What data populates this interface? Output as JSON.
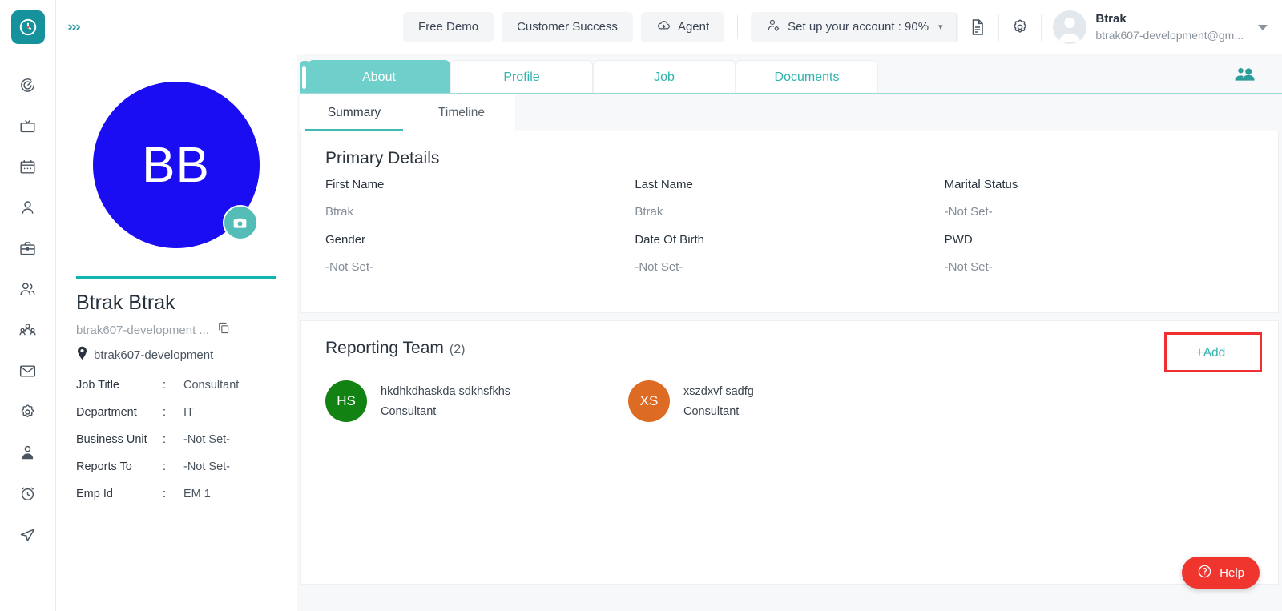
{
  "topbar": {
    "logo_icon": "clock-logo-icon",
    "expand_icon": "chevron-double-right-icon",
    "nav_items": [
      {
        "label": "Free Demo",
        "icon": null
      },
      {
        "label": "Customer Success",
        "icon": null
      },
      {
        "label": "Agent",
        "icon": "cloud-download-icon"
      }
    ],
    "setup": {
      "label": "Set up your account : 90%",
      "icon": "person-gear-icon",
      "caret": "caret-down-icon"
    },
    "doc_icon": "document-icon",
    "settings_icon": "gear-icon",
    "user": {
      "name": "Btrak",
      "email": "btrak607-development@gm...",
      "avatar_icon": "user-avatar-icon",
      "caret": "caret-down-icon"
    }
  },
  "sidebar": {
    "items": [
      {
        "name": "dashboard",
        "icon": "target-spiral-icon"
      },
      {
        "name": "media",
        "icon": "tv-icon"
      },
      {
        "name": "calendar",
        "icon": "calendar-icon"
      },
      {
        "name": "profile",
        "icon": "person-icon"
      },
      {
        "name": "jobs",
        "icon": "briefcase-icon"
      },
      {
        "name": "employees",
        "icon": "people-icon"
      },
      {
        "name": "org-chart",
        "icon": "org-group-icon"
      },
      {
        "name": "mail",
        "icon": "envelope-icon"
      },
      {
        "name": "settings",
        "icon": "gear-icon"
      },
      {
        "name": "account",
        "icon": "user-badge-icon"
      },
      {
        "name": "time-tracking",
        "icon": "alarm-clock-icon"
      },
      {
        "name": "send",
        "icon": "paper-plane-icon"
      }
    ]
  },
  "profile": {
    "initials": "BB",
    "avatar_color": "#1A0DF2",
    "camera_icon": "camera-icon",
    "full_name": "Btrak Btrak",
    "email": "btrak607-development ...",
    "copy_icon": "copy-icon",
    "location_icon": "location-pin-icon",
    "location": "btrak607-development",
    "fields": [
      {
        "key": "Job Title",
        "sep": ":",
        "value": "Consultant"
      },
      {
        "key": "Department",
        "sep": ":",
        "value": "IT"
      },
      {
        "key": "Business Unit",
        "sep": ":",
        "value": "-Not Set-"
      },
      {
        "key": "Reports To",
        "sep": ":",
        "value": "-Not Set-"
      },
      {
        "key": "Emp Id",
        "sep": ":",
        "value": "EM 1"
      }
    ]
  },
  "main": {
    "tabs": [
      {
        "label": "About",
        "active": true
      },
      {
        "label": "Profile",
        "active": false
      },
      {
        "label": "Job",
        "active": false
      },
      {
        "label": "Documents",
        "active": false
      }
    ],
    "team_icon": "people-group-icon",
    "subtabs": [
      {
        "label": "Summary",
        "active": true
      },
      {
        "label": "Timeline",
        "active": false
      }
    ],
    "primary_details": {
      "title": "Primary Details",
      "fields": [
        {
          "label": "First Name",
          "value": "Btrak"
        },
        {
          "label": "Last Name",
          "value": "Btrak"
        },
        {
          "label": "Marital Status",
          "value": "-Not Set-"
        },
        {
          "label": "Gender",
          "value": "-Not Set-"
        },
        {
          "label": "Date Of Birth",
          "value": "-Not Set-"
        },
        {
          "label": "PWD",
          "value": "-Not Set-"
        }
      ]
    },
    "reporting_team": {
      "title": "Reporting Team",
      "count": "(2)",
      "add_label": "+Add",
      "members": [
        {
          "initials": "HS",
          "color": "#128312",
          "name": "hkdhkdhaskda sdkhsfkhs",
          "role": "Consultant"
        },
        {
          "initials": "XS",
          "color": "#DE6B23",
          "name": "xszdxvf sadfg",
          "role": "Consultant"
        }
      ]
    }
  },
  "help": {
    "label": "Help",
    "icon": "question-circle-icon",
    "color": "#F0342E"
  },
  "accent": {
    "teal": "#6ECFCB",
    "teal_dark": "#15929B",
    "link": "#2FB3AE",
    "highlight": "#f03030"
  }
}
